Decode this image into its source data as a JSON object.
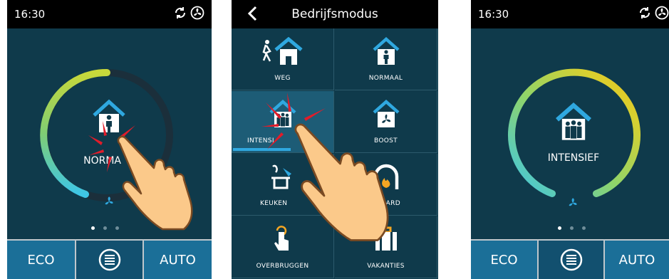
{
  "screen1": {
    "time": "16:30",
    "mode_label": "NORMA",
    "bottom": {
      "eco": "ECO",
      "auto": "AUTO"
    }
  },
  "screen2": {
    "title": "Bedrijfsmodus",
    "modes": [
      {
        "label": "WEG",
        "icon": "walking-away-icon"
      },
      {
        "label": "NORMAAL",
        "icon": "house-person-icon"
      },
      {
        "label": "INTENSIEF",
        "icon": "house-people-icon",
        "selected": true,
        "visible": "INTENSI"
      },
      {
        "label": "BOOST",
        "icon": "house-fan-icon"
      },
      {
        "label": "KEUKEN",
        "icon": "kitchen-icon"
      },
      {
        "label": "OPEN HAARD",
        "icon": "fireplace-icon",
        "visible": "PEN HAARD"
      },
      {
        "label": "OVERBRUGGEN",
        "icon": "touch-override-icon"
      },
      {
        "label": "VAKANTIES",
        "icon": "suitcase-icon"
      }
    ]
  },
  "screen3": {
    "time": "16:30",
    "mode_label": "INTENSIEF",
    "bottom": {
      "eco": "ECO",
      "auto": "AUTO"
    }
  },
  "colors": {
    "panel": "#0f3a4b",
    "button": "#1b6f98",
    "accent": "#2fa8e0",
    "ring_start": "#3ec6e6",
    "ring_end": "#e8c21c"
  }
}
